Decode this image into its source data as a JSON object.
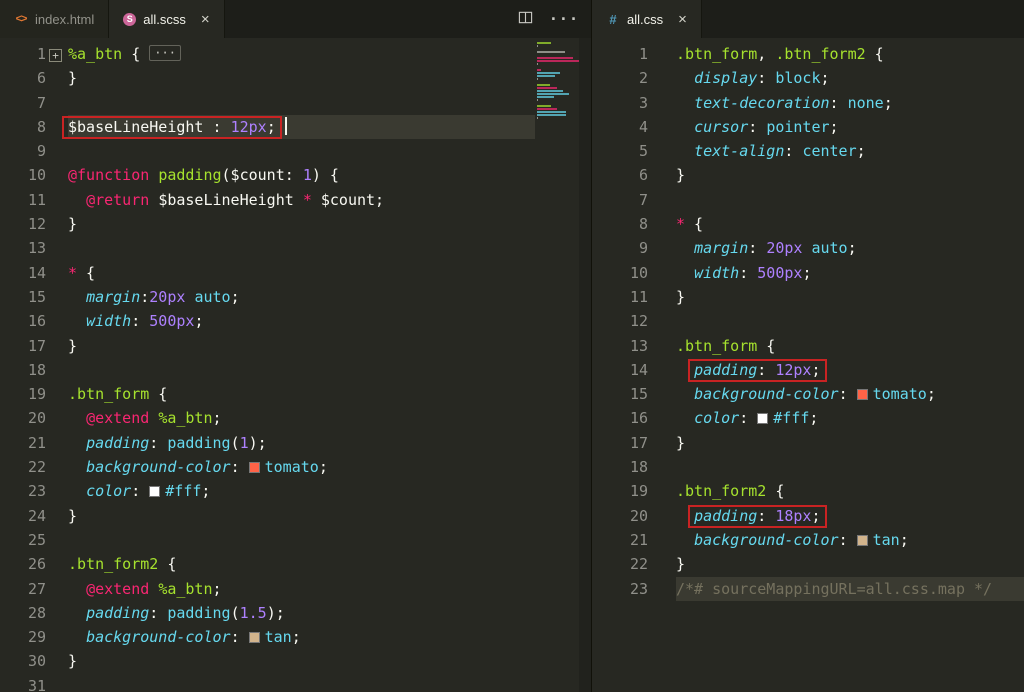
{
  "icons": {
    "html": "<>",
    "sass": "S",
    "css": "#",
    "close": "×",
    "more": "···",
    "split_editor": "split-editor",
    "fold_expand": "+",
    "fold_ellipsis": "···"
  },
  "theme": {
    "editor_bg": "#272822",
    "tabbar_bg": "#1d1e19",
    "current_line_bg": "#3a3a31",
    "line_number": "#90908a",
    "annotation_red": "#c92323",
    "syntax": {
      "keyword": "#f92672",
      "selector": "#a6e22e",
      "property": "#66d9ef",
      "value": "#66d9ef",
      "number": "#ae81ff",
      "plain": "#f8f8f2",
      "comment": "#75715e"
    },
    "swatches": {
      "tomato": "#ff6347",
      "white": "#ffffff",
      "tan": "#d2b48c"
    }
  },
  "left_pane": {
    "tabs": [
      {
        "label": "index.html",
        "icon": "html",
        "active": false
      },
      {
        "label": "all.scss",
        "icon": "sass",
        "active": true
      }
    ],
    "lines": [
      {
        "n": "1",
        "fold": true,
        "tokens": [
          [
            "%a_btn",
            "sel"
          ],
          [
            " { ",
            "plain"
          ],
          [
            "···",
            "ellipsis"
          ]
        ]
      },
      {
        "n": "6",
        "tokens": [
          [
            "}",
            "plain"
          ]
        ]
      },
      {
        "n": "7",
        "tokens": []
      },
      {
        "n": "8",
        "cur": true,
        "cursor": true,
        "box": [
          0,
          3
        ],
        "tokens": [
          [
            "$baseLineHeight",
            "plain"
          ],
          [
            " : ",
            "plain"
          ],
          [
            "12px",
            "num"
          ],
          [
            ";",
            "plain"
          ]
        ]
      },
      {
        "n": "9",
        "tokens": []
      },
      {
        "n": "10",
        "tokens": [
          [
            "@function ",
            "kw"
          ],
          [
            "padding",
            "sel"
          ],
          [
            "($count",
            "plain"
          ],
          [
            ": ",
            "plain"
          ],
          [
            "1",
            "num"
          ],
          [
            ") {",
            "plain"
          ]
        ]
      },
      {
        "n": "11",
        "tokens": [
          [
            "  ",
            "plain"
          ],
          [
            "@return ",
            "kw"
          ],
          [
            "$baseLineHeight ",
            "plain"
          ],
          [
            "*",
            "kw"
          ],
          [
            " $count;",
            "plain"
          ]
        ]
      },
      {
        "n": "12",
        "tokens": [
          [
            "}",
            "plain"
          ]
        ]
      },
      {
        "n": "13",
        "tokens": []
      },
      {
        "n": "14",
        "tokens": [
          [
            "*",
            "kw"
          ],
          [
            " {",
            "plain"
          ]
        ]
      },
      {
        "n": "15",
        "tokens": [
          [
            "  ",
            "plain"
          ],
          [
            "margin",
            "prop"
          ],
          [
            ":",
            "plain"
          ],
          [
            "20px",
            "num"
          ],
          [
            " ",
            "plain"
          ],
          [
            "auto",
            "val"
          ],
          [
            ";",
            "plain"
          ]
        ]
      },
      {
        "n": "16",
        "tokens": [
          [
            "  ",
            "plain"
          ],
          [
            "width",
            "prop"
          ],
          [
            ": ",
            "plain"
          ],
          [
            "500px",
            "num"
          ],
          [
            ";",
            "plain"
          ]
        ]
      },
      {
        "n": "17",
        "tokens": [
          [
            "}",
            "plain"
          ]
        ]
      },
      {
        "n": "18",
        "tokens": []
      },
      {
        "n": "19",
        "tokens": [
          [
            ".btn_form",
            "sel"
          ],
          [
            " {",
            "plain"
          ]
        ]
      },
      {
        "n": "20",
        "tokens": [
          [
            "  ",
            "plain"
          ],
          [
            "@extend ",
            "kw"
          ],
          [
            "%a_btn",
            "sel"
          ],
          [
            ";",
            "plain"
          ]
        ]
      },
      {
        "n": "21",
        "tokens": [
          [
            "  ",
            "plain"
          ],
          [
            "padding",
            "prop"
          ],
          [
            ": ",
            "plain"
          ],
          [
            "padding",
            "val"
          ],
          [
            "(",
            "plain"
          ],
          [
            "1",
            "num"
          ],
          [
            ");",
            "plain"
          ]
        ]
      },
      {
        "n": "22",
        "tokens": [
          [
            "  ",
            "plain"
          ],
          [
            "background-color",
            "prop"
          ],
          [
            ": ",
            "plain"
          ],
          [
            "tomato",
            "val",
            "#ff6347"
          ],
          [
            ";",
            "plain"
          ]
        ]
      },
      {
        "n": "23",
        "tokens": [
          [
            "  ",
            "plain"
          ],
          [
            "color",
            "prop"
          ],
          [
            ": ",
            "plain"
          ],
          [
            "#fff",
            "val",
            "#ffffff"
          ],
          [
            ";",
            "plain"
          ]
        ]
      },
      {
        "n": "24",
        "tokens": [
          [
            "}",
            "plain"
          ]
        ]
      },
      {
        "n": "25",
        "tokens": []
      },
      {
        "n": "26",
        "tokens": [
          [
            ".btn_form2",
            "sel"
          ],
          [
            " {",
            "plain"
          ]
        ]
      },
      {
        "n": "27",
        "tokens": [
          [
            "  ",
            "plain"
          ],
          [
            "@extend ",
            "kw"
          ],
          [
            "%a_btn",
            "sel"
          ],
          [
            ";",
            "plain"
          ]
        ]
      },
      {
        "n": "28",
        "tokens": [
          [
            "  ",
            "plain"
          ],
          [
            "padding",
            "prop"
          ],
          [
            ": ",
            "plain"
          ],
          [
            "padding",
            "val"
          ],
          [
            "(",
            "plain"
          ],
          [
            "1.5",
            "num"
          ],
          [
            ");",
            "plain"
          ]
        ]
      },
      {
        "n": "29",
        "tokens": [
          [
            "  ",
            "plain"
          ],
          [
            "background-color",
            "prop"
          ],
          [
            ": ",
            "plain"
          ],
          [
            "tan",
            "val",
            "#d2b48c"
          ],
          [
            ";",
            "plain"
          ]
        ]
      },
      {
        "n": "30",
        "tokens": [
          [
            "}",
            "plain"
          ]
        ]
      },
      {
        "n": "31",
        "tokens": []
      }
    ]
  },
  "right_pane": {
    "tabs": [
      {
        "label": "all.css",
        "icon": "css",
        "active": true
      }
    ],
    "lines": [
      {
        "n": "1",
        "tokens": [
          [
            ".btn_form",
            "sel"
          ],
          [
            ", ",
            "plain"
          ],
          [
            ".btn_form2",
            "sel"
          ],
          [
            " {",
            "plain"
          ]
        ]
      },
      {
        "n": "2",
        "tokens": [
          [
            "  ",
            "plain"
          ],
          [
            "display",
            "prop"
          ],
          [
            ": ",
            "plain"
          ],
          [
            "block",
            "val"
          ],
          [
            ";",
            "plain"
          ]
        ]
      },
      {
        "n": "3",
        "tokens": [
          [
            "  ",
            "plain"
          ],
          [
            "text-decoration",
            "prop"
          ],
          [
            ": ",
            "plain"
          ],
          [
            "none",
            "val"
          ],
          [
            ";",
            "plain"
          ]
        ]
      },
      {
        "n": "4",
        "tokens": [
          [
            "  ",
            "plain"
          ],
          [
            "cursor",
            "prop"
          ],
          [
            ": ",
            "plain"
          ],
          [
            "pointer",
            "val"
          ],
          [
            ";",
            "plain"
          ]
        ]
      },
      {
        "n": "5",
        "tokens": [
          [
            "  ",
            "plain"
          ],
          [
            "text-align",
            "prop"
          ],
          [
            ": ",
            "plain"
          ],
          [
            "center",
            "val"
          ],
          [
            ";",
            "plain"
          ]
        ]
      },
      {
        "n": "6",
        "tokens": [
          [
            "}",
            "plain"
          ]
        ]
      },
      {
        "n": "7",
        "tokens": []
      },
      {
        "n": "8",
        "tokens": [
          [
            "*",
            "kw"
          ],
          [
            " {",
            "plain"
          ]
        ]
      },
      {
        "n": "9",
        "tokens": [
          [
            "  ",
            "plain"
          ],
          [
            "margin",
            "prop"
          ],
          [
            ": ",
            "plain"
          ],
          [
            "20px",
            "num"
          ],
          [
            " ",
            "plain"
          ],
          [
            "auto",
            "val"
          ],
          [
            ";",
            "plain"
          ]
        ]
      },
      {
        "n": "10",
        "tokens": [
          [
            "  ",
            "plain"
          ],
          [
            "width",
            "prop"
          ],
          [
            ": ",
            "plain"
          ],
          [
            "500px",
            "num"
          ],
          [
            ";",
            "plain"
          ]
        ]
      },
      {
        "n": "11",
        "tokens": [
          [
            "}",
            "plain"
          ]
        ]
      },
      {
        "n": "12",
        "tokens": []
      },
      {
        "n": "13",
        "tokens": [
          [
            ".btn_form",
            "sel"
          ],
          [
            " {",
            "plain"
          ]
        ]
      },
      {
        "n": "14",
        "box": [
          1,
          4
        ],
        "tokens": [
          [
            "  ",
            "plain"
          ],
          [
            "padding",
            "prop"
          ],
          [
            ": ",
            "plain"
          ],
          [
            "12px",
            "num"
          ],
          [
            ";",
            "plain"
          ]
        ]
      },
      {
        "n": "15",
        "tokens": [
          [
            "  ",
            "plain"
          ],
          [
            "background-color",
            "prop"
          ],
          [
            ": ",
            "plain"
          ],
          [
            "tomato",
            "val",
            "#ff6347"
          ],
          [
            ";",
            "plain"
          ]
        ]
      },
      {
        "n": "16",
        "tokens": [
          [
            "  ",
            "plain"
          ],
          [
            "color",
            "prop"
          ],
          [
            ": ",
            "plain"
          ],
          [
            "#fff",
            "val",
            "#ffffff"
          ],
          [
            ";",
            "plain"
          ]
        ]
      },
      {
        "n": "17",
        "tokens": [
          [
            "}",
            "plain"
          ]
        ]
      },
      {
        "n": "18",
        "tokens": []
      },
      {
        "n": "19",
        "tokens": [
          [
            ".btn_form2",
            "sel"
          ],
          [
            " {",
            "plain"
          ]
        ]
      },
      {
        "n": "20",
        "box": [
          1,
          4
        ],
        "tokens": [
          [
            "  ",
            "plain"
          ],
          [
            "padding",
            "prop"
          ],
          [
            ": ",
            "plain"
          ],
          [
            "18px",
            "num"
          ],
          [
            ";",
            "plain"
          ]
        ]
      },
      {
        "n": "21",
        "tokens": [
          [
            "  ",
            "plain"
          ],
          [
            "background-color",
            "prop"
          ],
          [
            ": ",
            "plain"
          ],
          [
            "tan",
            "val",
            "#d2b48c"
          ],
          [
            ";",
            "plain"
          ]
        ]
      },
      {
        "n": "22",
        "tokens": [
          [
            "}",
            "plain"
          ]
        ]
      },
      {
        "n": "23",
        "hl": true,
        "tokens": [
          [
            "/*# sourceMappingURL=all.css.map */",
            "cmt"
          ]
        ]
      }
    ]
  }
}
